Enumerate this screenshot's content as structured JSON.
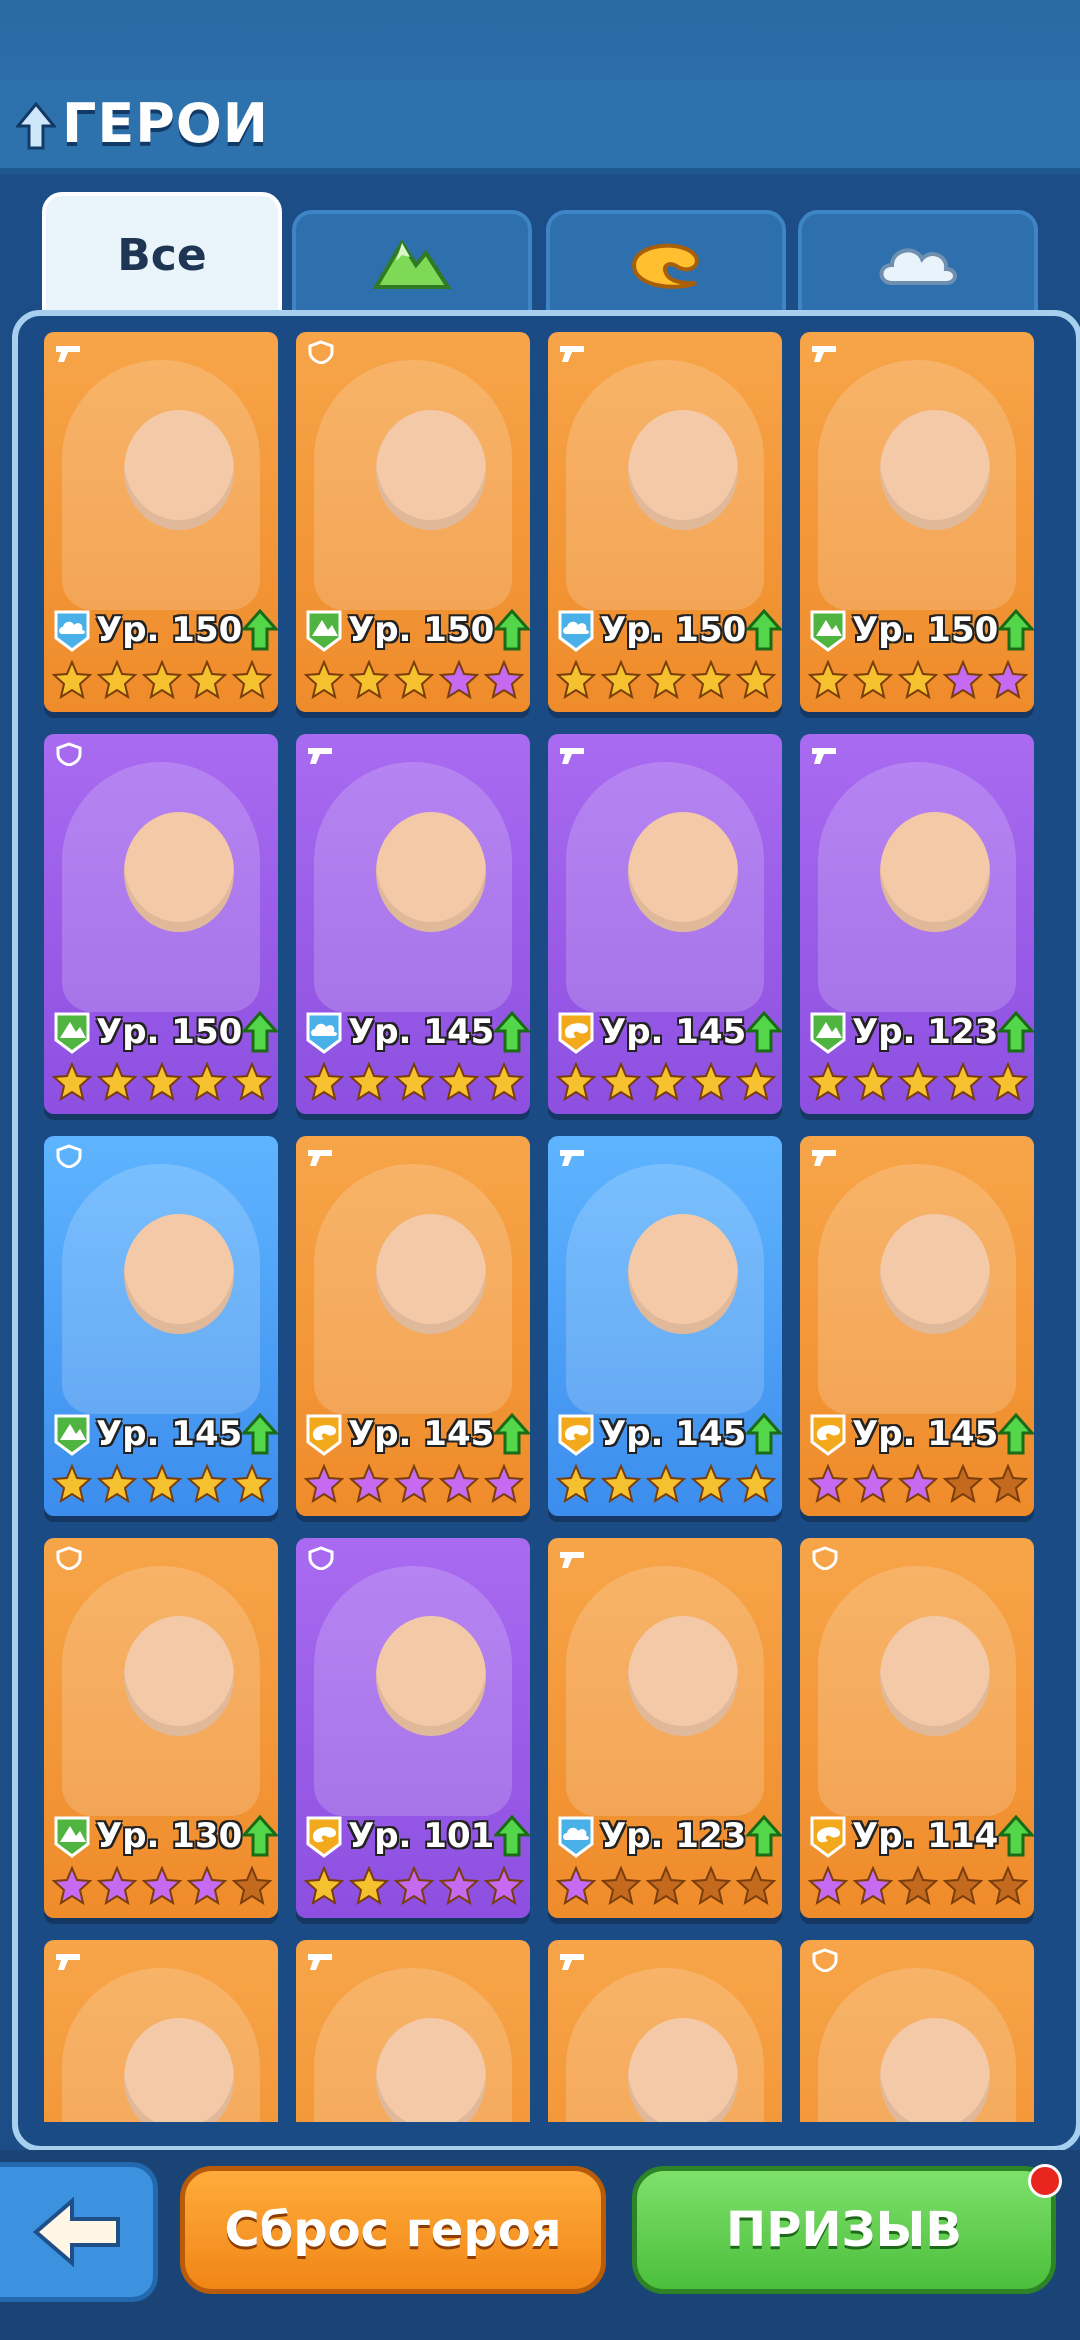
{
  "header": {
    "title": "ГЕРОИ"
  },
  "tabs": [
    {
      "label": "Все",
      "icon": "all"
    },
    {
      "label": "",
      "icon": "mountain-icon"
    },
    {
      "label": "",
      "icon": "swirl-icon"
    },
    {
      "label": "",
      "icon": "cloud-icon"
    }
  ],
  "colors": {
    "orange": "#ef8b2a",
    "purple": "#8d4fe0",
    "blue": "#3c8ded",
    "star_gold": "#f6c12e",
    "star_purple": "#c66af2",
    "star_empty": "#c46a1f"
  },
  "heroes": [
    {
      "level": "Ур. 150",
      "bg": "orange",
      "element": "cloud",
      "role": "gun",
      "stars": [
        "g",
        "g",
        "g",
        "g",
        "g"
      ]
    },
    {
      "level": "Ур. 150",
      "bg": "orange",
      "element": "mountain",
      "role": "shield",
      "stars": [
        "g",
        "g",
        "g",
        "p",
        "p"
      ]
    },
    {
      "level": "Ур. 150",
      "bg": "orange",
      "element": "cloud",
      "role": "gun",
      "stars": [
        "g",
        "g",
        "g",
        "g",
        "g"
      ]
    },
    {
      "level": "Ур. 150",
      "bg": "orange",
      "element": "mountain",
      "role": "gun",
      "stars": [
        "g",
        "g",
        "g",
        "p",
        "p"
      ]
    },
    {
      "level": "Ур. 150",
      "bg": "purple",
      "element": "mountain",
      "role": "shield",
      "stars": [
        "g",
        "g",
        "g",
        "g",
        "g"
      ]
    },
    {
      "level": "Ур. 145",
      "bg": "purple",
      "element": "cloud",
      "role": "gun",
      "stars": [
        "g",
        "g",
        "g",
        "g",
        "g"
      ]
    },
    {
      "level": "Ур. 145",
      "bg": "purple",
      "element": "swirl",
      "role": "gun",
      "stars": [
        "g",
        "g",
        "g",
        "g",
        "g"
      ]
    },
    {
      "level": "Ур. 123",
      "bg": "purple",
      "element": "mountain",
      "role": "gun",
      "stars": [
        "g",
        "g",
        "g",
        "g",
        "g"
      ]
    },
    {
      "level": "Ур. 145",
      "bg": "blue",
      "element": "mountain",
      "role": "shield",
      "stars": [
        "g",
        "g",
        "g",
        "g",
        "g"
      ]
    },
    {
      "level": "Ур. 145",
      "bg": "orange",
      "element": "swirl",
      "role": "gun",
      "stars": [
        "p",
        "p",
        "p",
        "p",
        "p"
      ]
    },
    {
      "level": "Ур. 145",
      "bg": "blue",
      "element": "swirl",
      "role": "gun",
      "stars": [
        "g",
        "g",
        "g",
        "g",
        "g"
      ]
    },
    {
      "level": "Ур. 145",
      "bg": "orange",
      "element": "swirl",
      "role": "gun",
      "stars": [
        "p",
        "p",
        "p",
        "e",
        "e"
      ]
    },
    {
      "level": "Ур. 130",
      "bg": "orange",
      "element": "mountain",
      "role": "shield",
      "stars": [
        "p",
        "p",
        "p",
        "p",
        "e"
      ]
    },
    {
      "level": "Ур. 101",
      "bg": "purple",
      "element": "swirl",
      "role": "shield",
      "stars": [
        "g",
        "g",
        "p",
        "p",
        "p"
      ]
    },
    {
      "level": "Ур. 123",
      "bg": "orange",
      "element": "cloud",
      "role": "gun",
      "stars": [
        "p",
        "e",
        "e",
        "e",
        "e"
      ]
    },
    {
      "level": "Ур. 114",
      "bg": "orange",
      "element": "swirl",
      "role": "shield",
      "stars": [
        "p",
        "p",
        "e",
        "e",
        "e"
      ]
    },
    {
      "level": "",
      "bg": "orange",
      "element": "",
      "role": "gun",
      "stars": []
    },
    {
      "level": "",
      "bg": "orange",
      "element": "",
      "role": "gun",
      "stars": []
    },
    {
      "level": "",
      "bg": "orange",
      "element": "",
      "role": "gun",
      "stars": []
    },
    {
      "level": "",
      "bg": "orange",
      "element": "",
      "role": "shield",
      "stars": []
    }
  ],
  "bottom": {
    "reset_label": "Сброс героя",
    "summon_label": "ПРИЗЫВ"
  }
}
